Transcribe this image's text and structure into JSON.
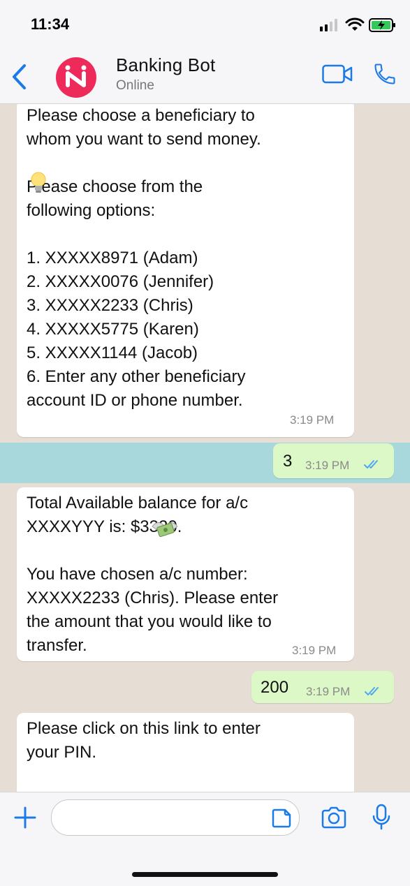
{
  "status_bar": {
    "time": "11:34"
  },
  "header": {
    "title": "Banking Bot",
    "subtitle": "Online"
  },
  "messages": [
    {
      "text": "Please choose a beneficiary to\nwhom you  want to send money.\n\n   Please choose from the\nfollowing options:\n\n1. XXXXX8971 (Adam)\n2. XXXXX0076 (Jennifer)\n3. XXXXX2233 (Chris)\n4. XXXXX5775 (Karen)\n5. XXXXX1144 (Jacob)\n6. Enter any other beneficiary\naccount ID or phone number.",
      "time": "3:19 PM"
    },
    {
      "text": "3",
      "time": "3:19 PM"
    },
    {
      "text": "Total Available balance for a/c\nXXXXYYY  is:       $3320.\n\nYou have chosen a/c number:\nXXXXX2233 (Chris). Please enter\nthe amount that you would like to\ntransfer.",
      "time": "3:19 PM"
    },
    {
      "text": "200",
      "time": "3:19 PM"
    },
    {
      "text": "Please click on this link to enter\nyour PIN."
    }
  ],
  "colors": {
    "accent": "#1a7ae8",
    "avatar": "#ee2a5b",
    "outgoing_bubble": "#dcf8c6",
    "highlight": "#a8d8db",
    "chat_background": "#e6ddd4"
  }
}
